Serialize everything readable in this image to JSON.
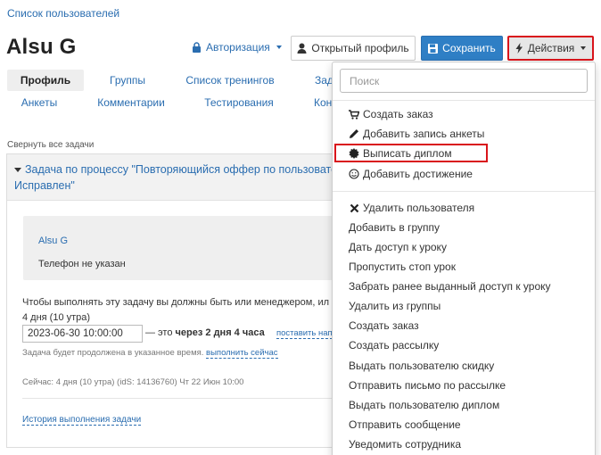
{
  "breadcrumb": "Список пользователей",
  "page_title": "Alsu G",
  "header": {
    "auth_label": "Авторизация",
    "open_profile_label": "Открытый профиль",
    "save_label": "Сохранить",
    "actions_label": "Действия"
  },
  "tabs_row1": [
    "Профиль",
    "Группы",
    "Список тренингов",
    "Зад"
  ],
  "tabs_row2": [
    "Анкеты",
    "Комментарии",
    "Тестирования",
    "Конт"
  ],
  "collapse_all": "Свернуть все задачи",
  "task": {
    "title_line1": "Задача по процессу \"Повторяющийся оффер по пользователя",
    "title_line2": "Исправлен\"",
    "user_name": "Alsu G",
    "phone": "Телефон не указан",
    "text_line1": "Чтобы выполнять эту задачу вы должны быть или менеджером, ил",
    "text_line2": "4 дня (10 утра)",
    "date_value": "2023-06-30 10:00:00",
    "eta_prefix": "— это",
    "eta_bold": "через 2 дня 4 часа",
    "set_link": "поставить нап",
    "prolong_text": "Задача будет продолжена в указанное время.",
    "prolong_link": "выполнить сейчас",
    "now_line": "Сейчас: 4 дня (10 утра) (idS: 14136760) Чт 22 Июн 10:00",
    "history_link": "История выполнения задачи"
  },
  "menu": {
    "search_placeholder": "Поиск",
    "group1": [
      {
        "icon": "cart-icon",
        "label": "Создать заказ"
      },
      {
        "icon": "pencil-icon",
        "label": "Добавить запись анкеты"
      },
      {
        "icon": "certificate-icon",
        "label": "Выписать диплом"
      },
      {
        "icon": "smile-icon",
        "label": "Добавить достижение"
      }
    ],
    "group2": [
      {
        "icon": "close-icon",
        "label": "Удалить пользователя"
      },
      {
        "icon": "",
        "label": "Добавить в группу"
      },
      {
        "icon": "",
        "label": "Дать доступ к уроку"
      },
      {
        "icon": "",
        "label": "Пропустить стоп урок"
      },
      {
        "icon": "",
        "label": "Забрать ранее выданный доступ к уроку"
      },
      {
        "icon": "",
        "label": "Удалить из группы"
      },
      {
        "icon": "",
        "label": "Создать заказ"
      },
      {
        "icon": "",
        "label": "Создать рассылку"
      },
      {
        "icon": "",
        "label": "Выдать пользователю скидку"
      },
      {
        "icon": "",
        "label": "Отправить письмо по рассылке"
      },
      {
        "icon": "",
        "label": "Выдать пользователю диплом"
      },
      {
        "icon": "",
        "label": "Отправить сообщение"
      },
      {
        "icon": "",
        "label": "Уведомить сотрудника"
      }
    ]
  },
  "colors": {
    "link": "#2a6db0",
    "primary": "#2f7fc5",
    "highlight": "#d9141b"
  }
}
